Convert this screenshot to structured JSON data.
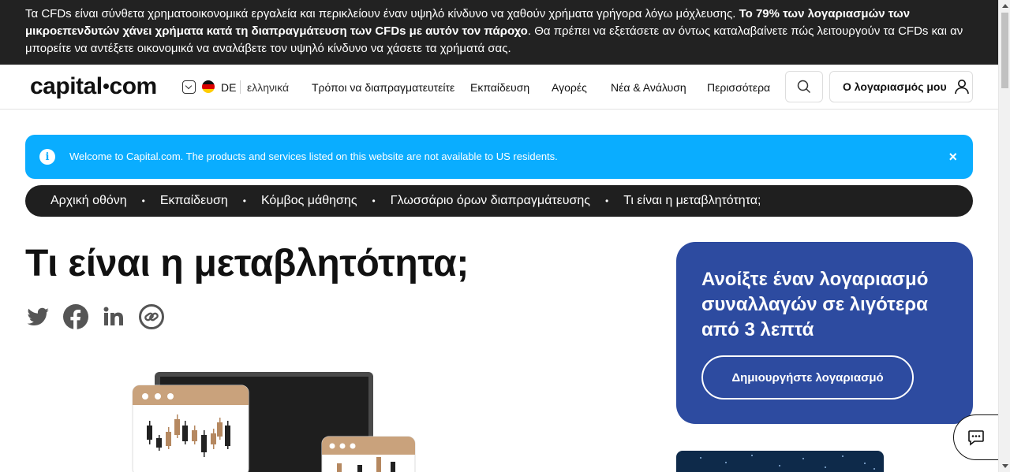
{
  "risk_banner": {
    "text_1": "Τα CFDs είναι σύνθετα χρηματοοικονομικά εργαλεία και περικλείουν έναν υψηλό κίνδυνο να χαθούν χρήματα γρήγορα λόγω μόχλευσης. ",
    "text_bold": "Το 79% των λογαριασμών των μικροεπενδυτών χάνει χρήματα κατά τη διαπραγμάτευση των CFDs με αυτόν τον πάροχο",
    "text_2": ". Θα πρέπει να εξετάσετε αν όντως καταλαβαίνετε πώς λειτουργούν τα CFDs και αν μπορείτε να αντέξετε οικονομικά να αναλάβετε τον υψηλό κίνδυνο να χάσετε τα χρήματά σας."
  },
  "header": {
    "logo_part_1": "capital",
    "logo_part_2": "com",
    "lang_code": "DE",
    "lang_name": "ελληνικά",
    "nav": [
      "Τρόποι να διαπραγματευτείτε",
      "Εκπαίδευση",
      "Αγορές",
      "Νέα & Ανάλυση",
      "Περισσότερα"
    ],
    "account_label": "Ο λογαριασμός μου"
  },
  "notice": {
    "text": "Welcome to Capital.com. The products and services listed on this website are not available to US residents.",
    "close": "×",
    "info": "i",
    "color": "#0aadff"
  },
  "breadcrumb": [
    "Αρχική οθόνη",
    "Εκπαίδευση",
    "Κόμβος μάθησης",
    "Γλωσσάριο όρων διαπραγμάτευσης",
    "Τι είναι η μεταβλητότητα;"
  ],
  "breadcrumb_sep": "•",
  "page": {
    "title": "Τι είναι η μεταβλητότητα;",
    "share_icons": [
      "twitter-icon",
      "facebook-icon",
      "linkedin-icon",
      "copy-link-icon"
    ]
  },
  "cta": {
    "headline": "Ανοίξτε έναν λογαριασμό συναλλαγών σε λιγότερα από 3 λεπτά",
    "button": "Δημιουργήστε λογαριασμό",
    "color": "#2d4ba0"
  }
}
